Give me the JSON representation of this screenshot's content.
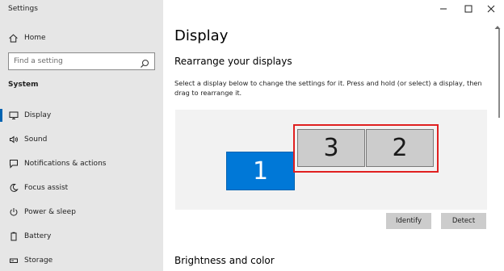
{
  "app": {
    "title": "Settings"
  },
  "sidebar": {
    "home_label": "Home",
    "search_placeholder": "Find a setting",
    "section_label": "System",
    "items": [
      {
        "label": "Display",
        "icon": "monitor-icon",
        "active": true
      },
      {
        "label": "Sound",
        "icon": "speaker-icon"
      },
      {
        "label": "Notifications & actions",
        "icon": "notifications-icon"
      },
      {
        "label": "Focus assist",
        "icon": "moon-icon"
      },
      {
        "label": "Power & sleep",
        "icon": "power-icon"
      },
      {
        "label": "Battery",
        "icon": "battery-icon"
      },
      {
        "label": "Storage",
        "icon": "storage-icon"
      }
    ]
  },
  "main": {
    "title": "Display",
    "rearrange_heading": "Rearrange your displays",
    "description": "Select a display below to change the settings for it. Press and hold (or select) a display, then drag to rearrange it.",
    "monitors": [
      {
        "number": "1",
        "selected": true
      },
      {
        "number": "3",
        "selected": false
      },
      {
        "number": "2",
        "selected": false
      }
    ],
    "identify_label": "Identify",
    "detect_label": "Detect",
    "brightness_heading": "Brightness and color"
  },
  "colors": {
    "accent": "#0078d7",
    "sidebar_bg": "#e6e6e6",
    "highlight": "#e02020"
  }
}
